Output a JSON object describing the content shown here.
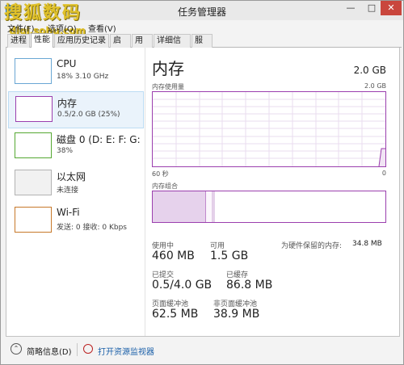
{
  "window": {
    "title": "任务管理器",
    "controls": [
      "—",
      "□",
      "✕"
    ]
  },
  "watermark": {
    "text": "搜狐数码",
    "url": "digi.sohu.com"
  },
  "menu": [
    "文件(F)",
    "选项(O)",
    "查看(V)"
  ],
  "tabs": [
    "进程",
    "性能",
    "应用历史记录",
    "启动",
    "用户",
    "详细信息",
    "服务"
  ],
  "active_tab": "性能",
  "sidebar": {
    "items": [
      {
        "title": "CPU",
        "sub": "18% 3.10 GHz",
        "icon": "cpu-graph-icon"
      },
      {
        "title": "内存",
        "sub": "0.5/2.0 GB (25%)",
        "icon": "memory-graph-icon",
        "selected": true
      },
      {
        "title": "磁盘 0 (D: E: F: G:",
        "sub": "38%",
        "icon": "disk-graph-icon"
      },
      {
        "title": "以太网",
        "sub": "未连接",
        "icon": "ethernet-graph-icon"
      },
      {
        "title": "Wi-Fi",
        "sub": "发送: 0 接收: 0 Kbps",
        "icon": "wifi-graph-icon"
      }
    ]
  },
  "main": {
    "title": "内存",
    "total": "2.0 GB",
    "usage_graph_label": "内存使用量",
    "usage_graph_max": "2.0 GB",
    "axis_left": "60 秒",
    "axis_right": "0",
    "composition_label": "内存组合",
    "stats": {
      "in_use_label": "使用中",
      "in_use_value": "460 MB",
      "available_label": "可用",
      "available_value": "1.5 GB",
      "reserved_label": "为硬件保留的内存:",
      "reserved_value": "34.8 MB",
      "committed_label": "已提交",
      "committed_value": "0.5/4.0 GB",
      "cached_label": "已缓存",
      "cached_value": "86.8 MB",
      "paged_label": "页面缓冲池",
      "paged_value": "62.5 MB",
      "nonpaged_label": "非页面缓冲池",
      "nonpaged_value": "38.9 MB"
    }
  },
  "footer": {
    "summary_label": "简略信息(D)",
    "resmon_label": "打开资源监视器"
  },
  "colors": {
    "memory": "#9b3fae",
    "cpu": "#6aa7d4",
    "disk": "#55a832",
    "wifi": "#c7782a",
    "ethernet": "#b2b2b2"
  }
}
